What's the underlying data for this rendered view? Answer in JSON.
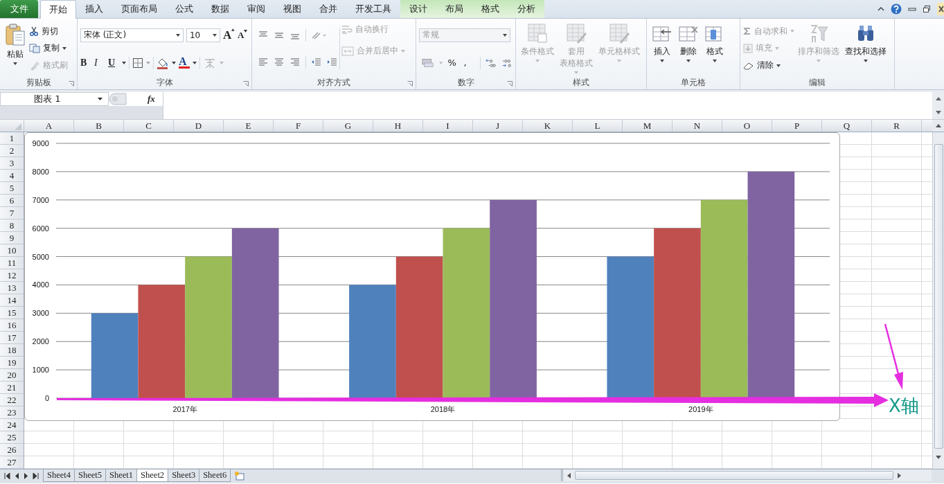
{
  "tabs": [
    {
      "label": "文件",
      "kind": "file",
      "selected": false
    },
    {
      "label": "开始",
      "kind": "main",
      "selected": true
    },
    {
      "label": "插入",
      "kind": "main",
      "selected": false
    },
    {
      "label": "页面布局",
      "kind": "main",
      "selected": false
    },
    {
      "label": "公式",
      "kind": "main",
      "selected": false
    },
    {
      "label": "数据",
      "kind": "main",
      "selected": false
    },
    {
      "label": "审阅",
      "kind": "main",
      "selected": false
    },
    {
      "label": "视图",
      "kind": "main",
      "selected": false
    },
    {
      "label": "合并",
      "kind": "main",
      "selected": false
    },
    {
      "label": "开发工具",
      "kind": "main",
      "selected": false
    },
    {
      "label": "设计",
      "kind": "context",
      "selected": false
    },
    {
      "label": "布局",
      "kind": "context",
      "selected": false
    },
    {
      "label": "格式",
      "kind": "context",
      "selected": false
    },
    {
      "label": "分析",
      "kind": "context",
      "selected": false
    }
  ],
  "ribbon": [
    {
      "label": "剪贴板",
      "buttons": [
        {
          "label": "粘贴",
          "disabled": false
        },
        {
          "label": "剪切",
          "disabled": false
        },
        {
          "label": "复制",
          "disabled": false
        },
        {
          "label": "格式刷",
          "disabled": true
        }
      ]
    },
    {
      "label": "字体",
      "font_name": "宋体 (正文)",
      "font_size": "10",
      "glyphs": [
        "A",
        "A",
        "B",
        "I",
        "U",
        "A"
      ],
      "phonetic": {
        "disabled": true
      }
    },
    {
      "label": "对齐方式",
      "buttons": [
        {
          "label": "自动换行",
          "disabled": true
        },
        {
          "label": "合并后居中",
          "disabled": true
        }
      ]
    },
    {
      "label": "数字",
      "format": {
        "value": "常规",
        "disabled": true
      },
      "glyphs": [
        "%",
        ","
      ]
    },
    {
      "label": "样式",
      "buttons": [
        {
          "lines": [
            "条件格式"
          ],
          "disabled": true
        },
        {
          "lines": [
            "套用",
            "表格格式"
          ],
          "disabled": true
        },
        {
          "lines": [
            "单元格样式"
          ],
          "disabled": true
        }
      ]
    },
    {
      "label": "单元格",
      "buttons": [
        {
          "label": "插入",
          "disabled": false
        },
        {
          "label": "删除",
          "disabled": false
        },
        {
          "label": "格式",
          "disabled": false
        }
      ]
    },
    {
      "label": "编辑",
      "buttons": [
        {
          "label": "自动求和",
          "disabled": true
        },
        {
          "label": "填充",
          "disabled": true
        },
        {
          "label": "清除",
          "disabled": false
        },
        {
          "label": "排序和筛选",
          "disabled": true
        },
        {
          "label": "查找和选择",
          "disabled": false
        }
      ]
    }
  ],
  "formula_bar": {
    "name_box": "图表 1",
    "fx": "fx"
  },
  "columns": [
    "A",
    "B",
    "C",
    "D",
    "E",
    "F",
    "G",
    "H",
    "I",
    "J",
    "K",
    "L",
    "M",
    "N",
    "O",
    "P",
    "Q",
    "R"
  ],
  "rows": [
    "1",
    "2",
    "3",
    "4",
    "5",
    "6",
    "7",
    "8",
    "9",
    "10",
    "11",
    "12",
    "13",
    "14",
    "15",
    "16",
    "17",
    "18",
    "19",
    "20",
    "21",
    "22",
    "23",
    "24",
    "25",
    "26",
    "27"
  ],
  "chart": {
    "chart_data": {
      "type": "bar",
      "categories": [
        "2017年",
        "2018年",
        "2019年"
      ],
      "series": [
        {
          "color": "#4f81bd",
          "values": [
            3000,
            4000,
            5000
          ]
        },
        {
          "color": "#c0504d",
          "values": [
            4000,
            5000,
            6000
          ]
        },
        {
          "color": "#9bbb59",
          "values": [
            5000,
            6000,
            7000
          ]
        },
        {
          "color": "#8064a2",
          "values": [
            6000,
            7000,
            8000
          ]
        }
      ],
      "ylim": [
        0,
        9000
      ],
      "grid": true,
      "yticks": [
        0,
        1000,
        2000,
        3000,
        4000,
        5000,
        6000,
        7000,
        8000,
        9000
      ]
    }
  },
  "annotation": {
    "label": "X轴"
  },
  "sheet_tabs": [
    {
      "label": "Sheet4",
      "selected": false
    },
    {
      "label": "Sheet5",
      "selected": false
    },
    {
      "label": "Sheet1",
      "selected": false
    },
    {
      "label": "Sheet2",
      "selected": true
    },
    {
      "label": "Sheet3",
      "selected": false
    },
    {
      "label": "Sheet6",
      "selected": false
    }
  ]
}
